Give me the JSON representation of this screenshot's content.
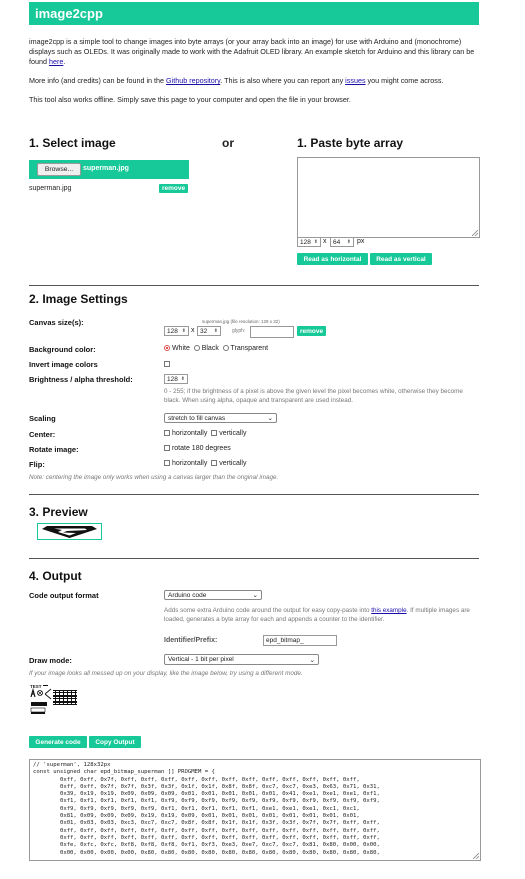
{
  "header": {
    "title": "image2cpp"
  },
  "intro": {
    "p1_a": "image2cpp is a simple tool to change images into byte arrays (or your array back into an image) for use with Arduino and (monochrome) displays such as OLEDs. It was originally made to work with the Adafruit OLED library. An example sketch for Arduino and this library can be found ",
    "p1_link": "here",
    "p1_b": ".",
    "p2_a": "More info (and credits) can be found in the ",
    "p2_link1": "Github repository",
    "p2_b": ". This is also where you can report any ",
    "p2_link2": "issues",
    "p2_c": " you might come across.",
    "p3": "This tool also works offline. Simply save this page to your computer and open the file in your browser."
  },
  "select": {
    "title": "1. Select image",
    "browse": "Browse...",
    "filename": "superman.jpg",
    "file_label": "superman.jpg",
    "remove": "remove"
  },
  "or_label": "or",
  "paste": {
    "title": "1. Paste byte array",
    "width": "128",
    "height": "64",
    "x": "x",
    "px": "px",
    "read_h": "Read as horizontal",
    "read_v": "Read as vertical"
  },
  "settings": {
    "title": "2. Image Settings",
    "canvas_label": "Canvas size(s):",
    "canvas_file": "superman.jpg (file resolution: 128 x 32)",
    "canvas_w": "128",
    "canvas_x": "x",
    "canvas_h": "32",
    "glyph": "glyph:",
    "remove": "remove",
    "bg_label": "Background color:",
    "bg_white": "White",
    "bg_black": "Black",
    "bg_transparent": "Transparent",
    "invert_label": "Invert image colors",
    "brightness_label": "Brightness / alpha threshold:",
    "brightness_value": "128",
    "brightness_hint": "0 - 255; if the brightness of a pixel is above the given level the pixel becomes white, otherwise they become black. When using alpha, opaque and transparent are used instead.",
    "scaling_label": "Scaling",
    "scaling_value": "stretch to fill canvas",
    "center_label": "Center:",
    "horizontally": "horizontally",
    "vertically": "vertically",
    "rotate_label": "Rotate image:",
    "rotate_value": "rotate 180 degrees",
    "flip_label": "Flip:",
    "flip_h": "horizontally",
    "flip_v": "vertically",
    "note": "Note: centering the image only works when using a canvas larger than the original image."
  },
  "preview": {
    "title": "3. Preview"
  },
  "output": {
    "title": "4. Output",
    "format_label": "Code output format",
    "format_value": "Arduino code",
    "format_hint_a": "Adds some extra Arduino code around the output for easy copy-paste into ",
    "format_hint_link": "this example",
    "format_hint_b": ". If multiple images are loaded, generates a byte array for each and appends a counter to the identifier.",
    "identifier_label": "Identifier/Prefix:",
    "identifier_value": "epd_bitmap_",
    "draw_label": "Draw mode:",
    "draw_value": "Vertical - 1 bit per pixel",
    "draw_hint": "If your image looks all messed up on your display, like the image below, try using a different mode.",
    "test_text": "TEST",
    "generate": "Generate code",
    "copy": "Copy Output",
    "code": "// 'superman', 128x32px\nconst unsigned char epd_bitmap_superman [] PROGMEM = {\n\t0xff, 0xff, 0x7f, 0xff, 0xff, 0xff, 0xff, 0xff, 0xff, 0xff, 0xff, 0xff, 0xff, 0xff, 0xff,\n\t0xff, 0xff, 0x7f, 0x7f, 0x3f, 0x3f, 0x1f, 0x1f, 0x8f, 0x8f, 0xc7, 0xc7, 0xe3, 0x63, 0x71, 0x31,\n\t0x39, 0x19, 0x19, 0x09, 0x09, 0x09, 0x01, 0x01, 0x01, 0x01, 0x01, 0x41, 0xe1, 0xe1, 0xe1, 0xf1,\n\t0xf1, 0xf1, 0xf1, 0xf1, 0xf1, 0xf9, 0xf9, 0xf9, 0xf9, 0xf9, 0xf9, 0xf9, 0xf9, 0xf9, 0xf9, 0xf9,\n\t0xf9, 0xf9, 0xf9, 0xf9, 0xf9, 0xf1, 0xf1, 0xf1, 0xf1, 0xf1, 0xe1, 0xe1, 0xe1, 0xc1, 0xc1,\n\t0x81, 0x09, 0x09, 0x09, 0x19, 0x19, 0x09, 0x01, 0x01, 0x01, 0x01, 0x01, 0x01, 0x01, 0x01,\n\t0x01, 0x03, 0x03, 0xc3, 0xc7, 0xc7, 0x8f, 0x8f, 0x1f, 0x1f, 0x3f, 0x3f, 0x7f, 0x7f, 0xff, 0xff,\n\t0xff, 0xff, 0xff, 0xff, 0xff, 0xff, 0xff, 0xff, 0xff, 0xff, 0xff, 0xff, 0xff, 0xff, 0xff, 0xff,\n\t0xff, 0xff, 0xff, 0xff, 0xff, 0xff, 0xff, 0xff, 0xff, 0xff, 0xff, 0xff, 0xff, 0xff, 0xff, 0xff,\n\t0xfe, 0xfc, 0xfc, 0xf8, 0xf8, 0xf8, 0xf1, 0xf3, 0xe3, 0xe7, 0xc7, 0xc7, 0x81, 0x80, 0x00, 0x00,\n\t0x00, 0x00, 0x00, 0x00, 0x80, 0x80, 0x80, 0x80, 0x80, 0x80, 0x80, 0x80, 0x80, 0x80, 0x80, 0x80,"
  },
  "colors": {
    "accent": "#17c998",
    "link": "#1a0dab"
  }
}
